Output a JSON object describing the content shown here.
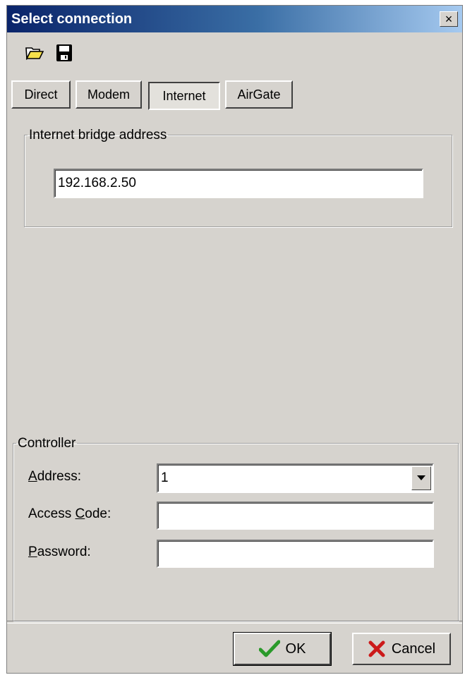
{
  "window": {
    "title": "Select connection",
    "close_glyph": "×"
  },
  "toolbar": {
    "open_icon": "folder-open-icon",
    "save_icon": "floppy-save-icon"
  },
  "tabs": [
    {
      "label": "Direct",
      "active": false
    },
    {
      "label": "Modem",
      "active": false
    },
    {
      "label": "Internet",
      "active": true
    },
    {
      "label": "AirGate",
      "active": false
    }
  ],
  "internet": {
    "group_label": "Internet bridge address",
    "address_value": "192.168.2.50"
  },
  "controller": {
    "group_label": "Controller",
    "address": {
      "label_hotkey": "A",
      "label_rest": "ddress:",
      "value": "1"
    },
    "access_code": {
      "label_pre": "Access ",
      "label_hotkey": "C",
      "label_post": "ode:",
      "value": ""
    },
    "password": {
      "label_hotkey": "P",
      "label_rest": "assword:",
      "value": ""
    }
  },
  "buttons": {
    "ok_label": "OK",
    "cancel_label": "Cancel"
  },
  "colors": {
    "face": "#d6d3ce",
    "title_start": "#0a246a",
    "title_end": "#a6caf0",
    "ok_check": "#2a9a2a",
    "cancel_x": "#cc1a1a"
  }
}
